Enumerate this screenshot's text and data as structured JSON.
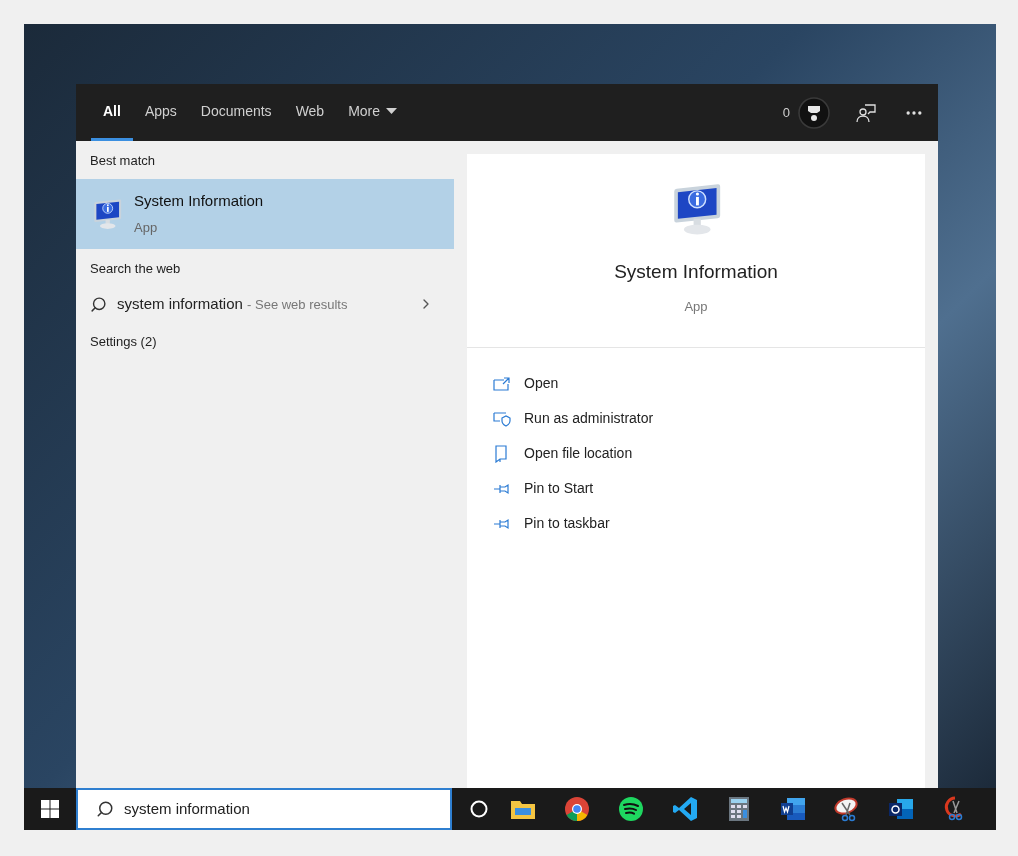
{
  "tabs": [
    {
      "label": "All",
      "selected": true,
      "has_menu": false
    },
    {
      "label": "Apps",
      "selected": false,
      "has_menu": false
    },
    {
      "label": "Documents",
      "selected": false,
      "has_menu": false
    },
    {
      "label": "Web",
      "selected": false,
      "has_menu": false
    },
    {
      "label": "More",
      "selected": false,
      "has_menu": true
    }
  ],
  "header": {
    "points": "0"
  },
  "results": {
    "best_match_heading": "Best match",
    "best_match": {
      "title": "System Information",
      "subtitle": "App",
      "selected": true
    },
    "web_heading": "Search the web",
    "web_result": {
      "query": "system information",
      "hint": "- See web results"
    },
    "settings_heading": "Settings (2)"
  },
  "preview": {
    "title": "System Information",
    "subtitle": "App",
    "actions": [
      {
        "label": "Open",
        "kind": "open"
      },
      {
        "label": "Run as administrator",
        "kind": "admin"
      },
      {
        "label": "Open file location",
        "kind": "folder"
      },
      {
        "label": "Pin to Start",
        "kind": "pin"
      },
      {
        "label": "Pin to taskbar",
        "kind": "pin"
      }
    ]
  },
  "taskbar": {
    "search": {
      "value": "system information"
    },
    "apps": [
      {
        "kind": "folder"
      },
      {
        "kind": "browser"
      },
      {
        "kind": "music"
      },
      {
        "kind": "code"
      },
      {
        "kind": "calculator"
      },
      {
        "kind": "document"
      },
      {
        "kind": "snip"
      },
      {
        "kind": "mail"
      },
      {
        "kind": "sketch"
      }
    ]
  }
}
